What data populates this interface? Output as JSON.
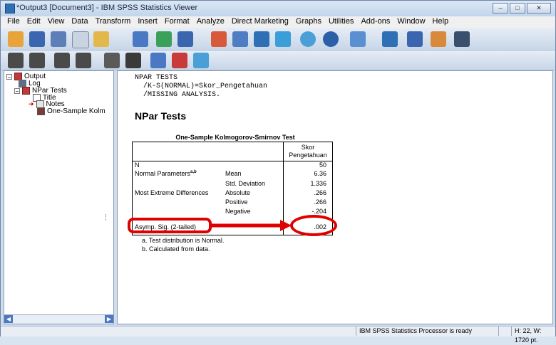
{
  "window": {
    "title": "*Output3 [Document3] - IBM SPSS Statistics Viewer"
  },
  "menu": [
    "File",
    "Edit",
    "View",
    "Data",
    "Transform",
    "Insert",
    "Format",
    "Analyze",
    "Direct Marketing",
    "Graphs",
    "Utilities",
    "Add-ons",
    "Window",
    "Help"
  ],
  "tree": {
    "root": "Output",
    "log": "Log",
    "npar": "NPar Tests",
    "title": "Title",
    "notes": "Notes",
    "ks": "One-Sample Kolm"
  },
  "syntax": {
    "line1": "NPAR TESTS",
    "line2": "  /K-S(NORMAL)=Skor_Pengetahuan",
    "line3": "  /MISSING ANALYSIS."
  },
  "heading": "NPar Tests",
  "table": {
    "title": "One-Sample Kolmogorov-Smirnov Test",
    "col_header_1": "Skor",
    "col_header_2": "Pengetahuan",
    "rows": [
      {
        "label": "N",
        "sub": "",
        "value": "50"
      },
      {
        "label": "Normal Parameters",
        "sup": "a,b",
        "sub": "Mean",
        "value": "6.36"
      },
      {
        "label": "",
        "sub": "Std. Deviation",
        "value": "1.336"
      },
      {
        "label": "Most Extreme Differences",
        "sub": "Absolute",
        "value": ".266"
      },
      {
        "label": "",
        "sub": "Positive",
        "value": ".266"
      },
      {
        "label": "",
        "sub": "Negative",
        "value": "-.204"
      }
    ],
    "sig_label": "Asymp. Sig. (2-tailed)",
    "sig_value": ".002",
    "note_a": "a. Test distribution is Normal.",
    "note_b": "b. Calculated from data."
  },
  "status": {
    "processor": "IBM SPSS Statistics Processor is ready",
    "dims": "H: 22, W: 1720 pt."
  },
  "colors": {
    "highlight": "#e00000",
    "accent": "#2f6fb6"
  }
}
